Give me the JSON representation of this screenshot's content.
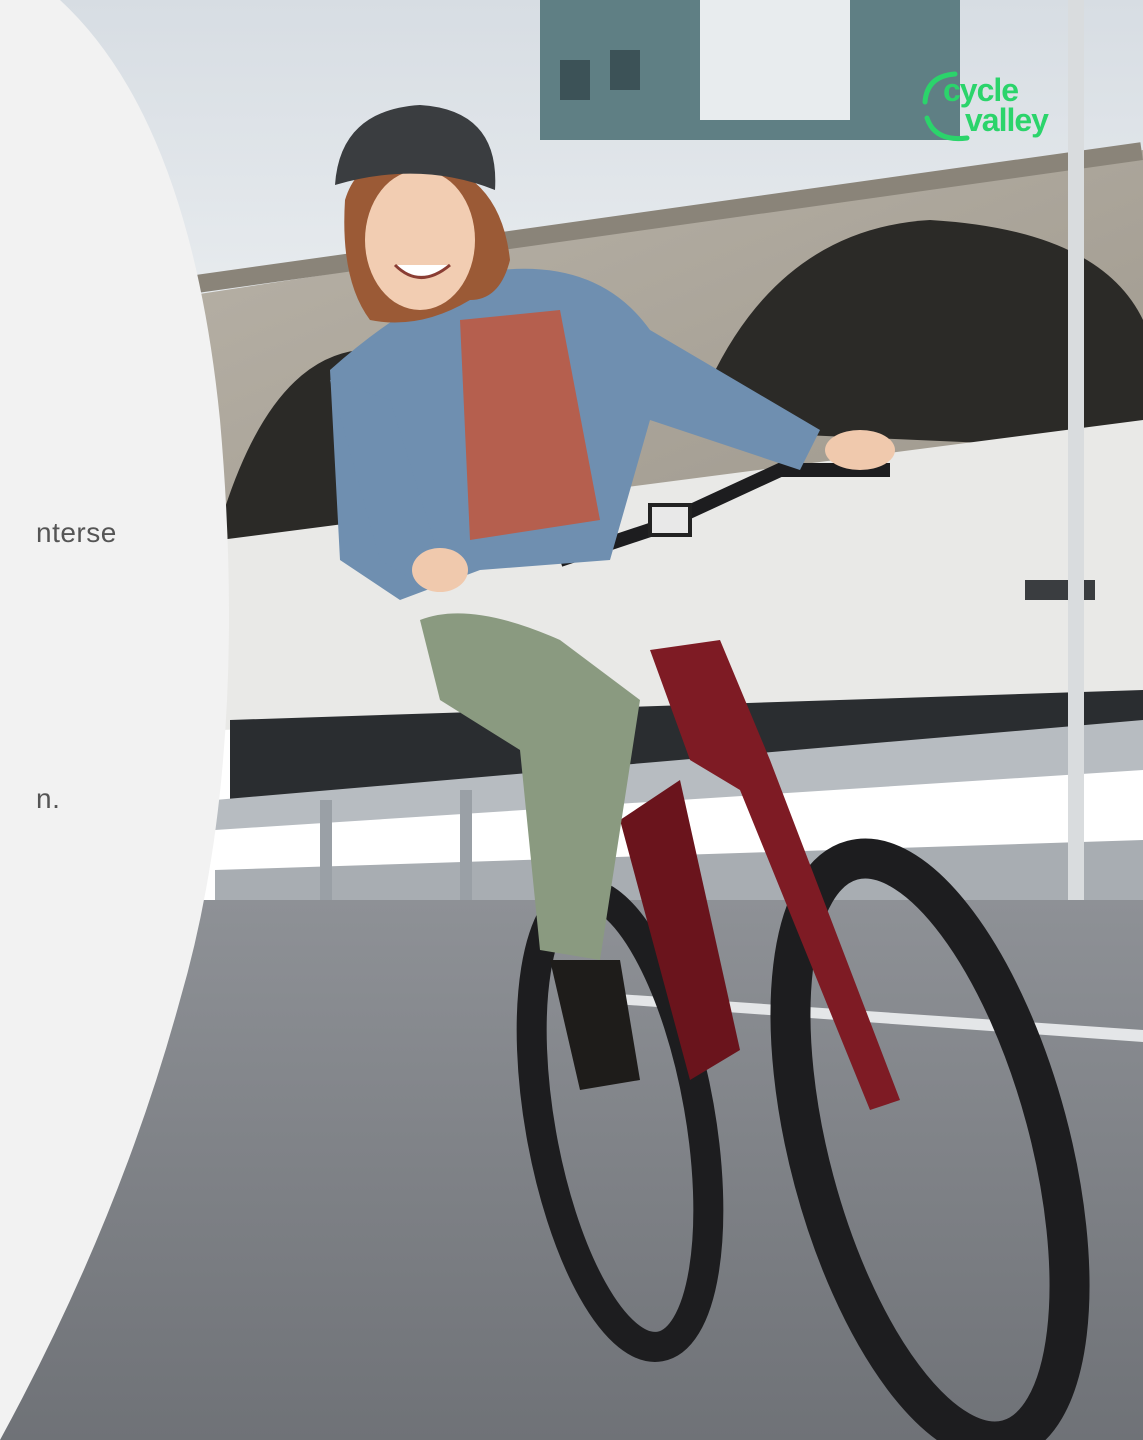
{
  "slide": {
    "text_fragments": [
      "nterse",
      "n."
    ]
  },
  "brand": {
    "logo_line1": "cycle",
    "logo_line2": "valley",
    "logo_color": "#2bd46b",
    "panel_color": "#f2f2f2"
  },
  "photo": {
    "subject": "woman-riding-e-bike-icon"
  }
}
